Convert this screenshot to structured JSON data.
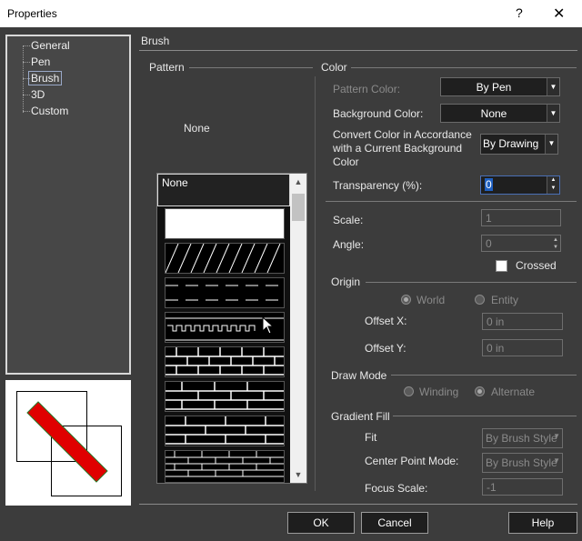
{
  "window": {
    "title": "Properties",
    "help_glyph": "?",
    "close_glyph": "✕"
  },
  "tree": {
    "items": [
      "General",
      "Pen",
      "Brush",
      "3D",
      "Custom"
    ],
    "selected": "Brush"
  },
  "panel_title": "Brush",
  "pattern": {
    "header": "Pattern",
    "current": "None",
    "list_first": "None"
  },
  "color": {
    "header": "Color",
    "pattern_color_label": "Pattern Color:",
    "pattern_color_value": "By Pen",
    "background_color_label": "Background Color:",
    "background_color_value": "None",
    "convert_label_1": "Convert Color in Accordance",
    "convert_label_2": "with a Current Background",
    "convert_label_3": "Color",
    "convert_value": "By Drawing",
    "transparency_label": "Transparency (%):",
    "transparency_value": "0"
  },
  "scale": {
    "label": "Scale:",
    "value": "1"
  },
  "angle": {
    "label": "Angle:",
    "value": "0"
  },
  "crossed": {
    "label": "Crossed",
    "checked": false
  },
  "origin": {
    "header": "Origin",
    "world": "World",
    "entity": "Entity",
    "offset_x_label": "Offset X:",
    "offset_x_value": "0 in",
    "offset_y_label": "Offset Y:",
    "offset_y_value": "0 in"
  },
  "draw_mode": {
    "header": "Draw Mode",
    "winding": "Winding",
    "alternate": "Alternate"
  },
  "gradient": {
    "header": "Gradient Fill",
    "fit_label": "Fit",
    "fit_value": "By Brush Style",
    "center_label": "Center Point Mode:",
    "center_value": "By Brush Style",
    "focus_label": "Focus Scale:",
    "focus_value": "-1"
  },
  "buttons": {
    "ok": "OK",
    "cancel": "Cancel",
    "help": "Help"
  },
  "colors": {
    "bg": "#3c3c3c",
    "field": "#1f1f1f",
    "accent": "#4a6fb5",
    "preview_fill": "#e00000"
  }
}
